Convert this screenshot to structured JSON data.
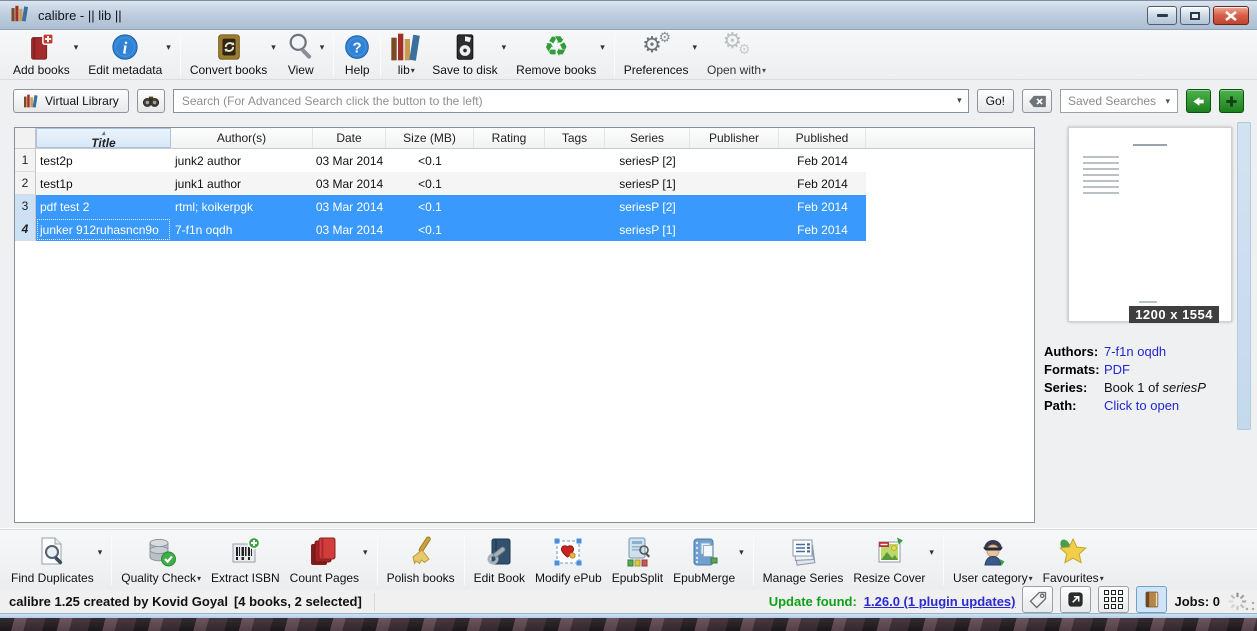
{
  "colors": {
    "selection_blue": "#3a99fc",
    "link_blue": "#2626cf",
    "update_green": "#0fa018"
  },
  "window": {
    "title": "calibre - || lib ||"
  },
  "toolbar": {
    "items": [
      {
        "label": "Add books"
      },
      {
        "label": "Edit metadata"
      },
      {
        "label": "Convert books"
      },
      {
        "label": "View"
      },
      {
        "label": "Help"
      },
      {
        "label": "lib"
      },
      {
        "label": "Save to disk"
      },
      {
        "label": "Remove books"
      },
      {
        "label": "Preferences"
      },
      {
        "label": "Open with"
      }
    ]
  },
  "searchbar": {
    "virtual_library_label": "Virtual Library",
    "search_placeholder": "Search (For Advanced Search click the button to the left)",
    "go_label": "Go!",
    "saved_searches_label": "Saved Searches"
  },
  "table": {
    "columns": [
      "Title",
      "Author(s)",
      "Date",
      "Size (MB)",
      "Rating",
      "Tags",
      "Series",
      "Publisher",
      "Published"
    ],
    "rows": [
      {
        "num": "1",
        "title": "test2p",
        "authors": "junk2 author",
        "date": "03 Mar 2014",
        "size": "<0.1",
        "rating": "",
        "tags": "",
        "series": "seriesP [2]",
        "publisher": "",
        "published": "Feb 2014"
      },
      {
        "num": "2",
        "title": "test1p",
        "authors": "junk1 author",
        "date": "03 Mar 2014",
        "size": "<0.1",
        "rating": "",
        "tags": "",
        "series": "seriesP [1]",
        "publisher": "",
        "published": "Feb 2014"
      },
      {
        "num": "3",
        "title": "pdf test 2",
        "authors": "rtml; koikerpgk",
        "date": "03 Mar 2014",
        "size": "<0.1",
        "rating": "",
        "tags": "",
        "series": "seriesP [2]",
        "publisher": "",
        "published": "Feb 2014"
      },
      {
        "num": "4",
        "title": "junker 912ruhasncn9o",
        "authors": "7-f1n oqdh",
        "date": "03 Mar 2014",
        "size": "<0.1",
        "rating": "",
        "tags": "",
        "series": "seriesP [1]",
        "publisher": "",
        "published": "Feb 2014"
      }
    ]
  },
  "details": {
    "cover_size": "1200 x 1554",
    "authors_label": "Authors:",
    "authors_value": "7-f1n oqdh",
    "formats_label": "Formats:",
    "formats_value": "PDF",
    "series_label": "Series:",
    "series_prefix": "Book 1 of ",
    "series_name": "seriesP",
    "path_label": "Path:",
    "path_value": "Click to open"
  },
  "bottom_toolbar": {
    "items": [
      {
        "label": "Find Duplicates"
      },
      {
        "label": "Quality Check"
      },
      {
        "label": "Extract ISBN"
      },
      {
        "label": "Count Pages"
      },
      {
        "label": "Polish books"
      },
      {
        "label": "Edit Book"
      },
      {
        "label": "Modify ePub"
      },
      {
        "label": "EpubSplit"
      },
      {
        "label": "EpubMerge"
      },
      {
        "label": "Manage Series"
      },
      {
        "label": "Resize Cover"
      },
      {
        "label": "User category"
      },
      {
        "label": "Favourites"
      }
    ]
  },
  "statusbar": {
    "version_text": "calibre 1.25 created by Kovid Goyal",
    "books_count": "[4 books, 2 selected]",
    "update_label": "Update found:",
    "update_link": "1.26.0 (1 plugin updates)",
    "jobs_label": "Jobs: 0"
  }
}
